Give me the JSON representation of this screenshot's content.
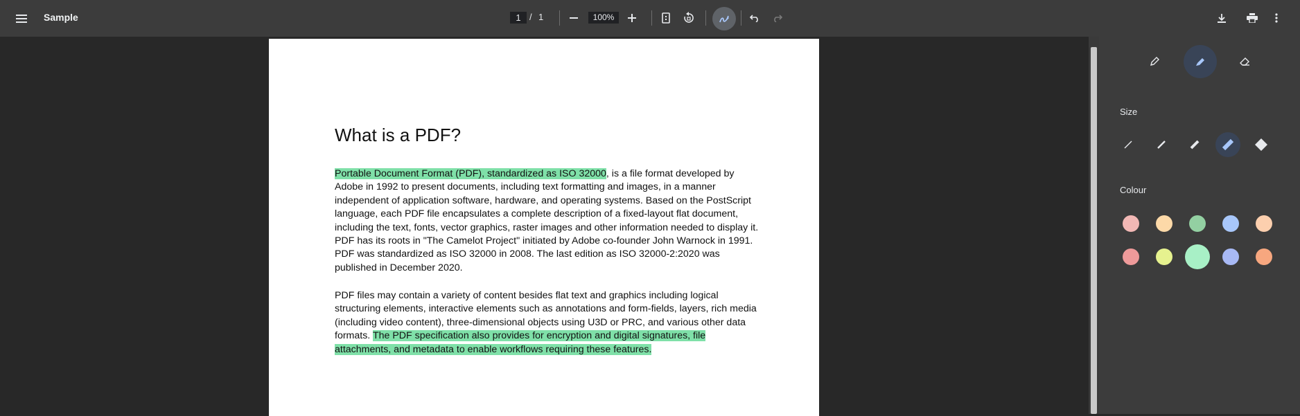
{
  "toolbar": {
    "title": "Sample",
    "page_current": "1",
    "page_separator": "/",
    "page_total": "1",
    "zoom": "100%"
  },
  "document": {
    "heading": "What is a PDF?",
    "para1_highlight": "Portable Document Format (PDF), standardized as ISO 32000",
    "para1_rest": ", is a file format developed by Adobe in 1992 to present documents, including text formatting and images, in a manner independent of application software, hardware, and operating systems. Based on the PostScript language, each PDF file encapsulates a complete description of a fixed-layout flat document, including the text, fonts, vector graphics, raster images and other information needed to display it. PDF has its roots in \"The Camelot Project\" initiated by Adobe co-founder John Warnock in 1991. PDF was standardized as ISO 32000 in 2008. The last edition as ISO 32000-2:2020 was published in December 2020.",
    "para2_plain": "PDF files may contain a variety of content besides flat text and graphics including logical structuring elements, interactive elements such as annotations and form-fields, layers, rich media (including video content), three-dimensional objects using U3D or PRC, and various other data formats. ",
    "para2_highlight": "The PDF specification also provides for encryption and digital signatures, file attachments, and metadata to enable workflows requiring these features."
  },
  "panel": {
    "size_label": "Size",
    "colour_label": "Colour",
    "tools": [
      "pen-icon",
      "highlighter-icon",
      "eraser-icon"
    ],
    "active_tool": "highlighter-icon",
    "active_size_index": 3,
    "colours_row1": [
      "#f2b8b5",
      "#fdd9a8",
      "#93d0a2",
      "#a8c7fa",
      "#fccfae"
    ],
    "colours_row2": [
      "#ee9a9a",
      "#e6f28f",
      "#a8f0c6",
      "#a8b9f5",
      "#f7a77f"
    ],
    "active_colour": "#a8f0c6"
  },
  "colors": {
    "toolbar_bg": "#3c3c3c",
    "viewer_bg": "#282828",
    "highlight": "#7fe0a8",
    "active_tool_bg": "#394457"
  }
}
